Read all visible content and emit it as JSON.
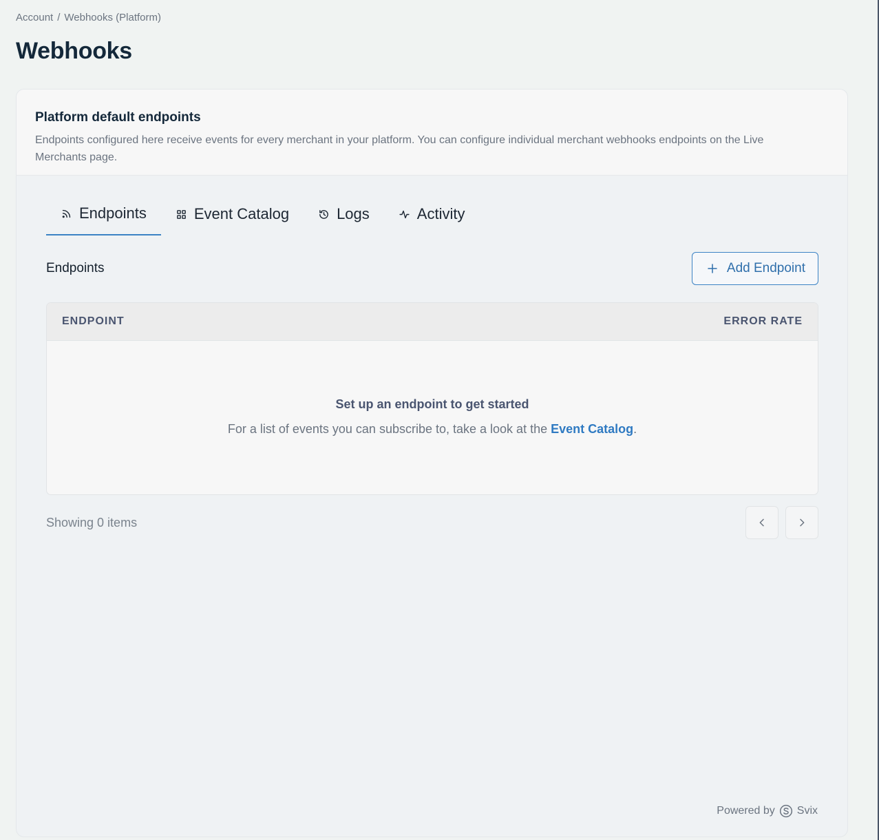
{
  "breadcrumb": {
    "items": [
      "Account",
      "/",
      "Webhooks (Platform)"
    ]
  },
  "page": {
    "title": "Webhooks"
  },
  "card": {
    "title": "Platform default endpoints",
    "description": "Endpoints configured here receive events for every merchant in your platform. You can configure individual merchant webhooks endpoints on the Live Merchants page."
  },
  "tabs": [
    {
      "label": "Endpoints",
      "icon": "rss-icon",
      "active": true
    },
    {
      "label": "Event Catalog",
      "icon": "grid-icon",
      "active": false
    },
    {
      "label": "Logs",
      "icon": "history-icon",
      "active": false
    },
    {
      "label": "Activity",
      "icon": "activity-icon",
      "active": false
    }
  ],
  "endpoints": {
    "section_title": "Endpoints",
    "add_button_label": "Add Endpoint",
    "table": {
      "columns": [
        "ENDPOINT",
        "ERROR RATE"
      ],
      "empty_title": "Set up an endpoint to get started",
      "empty_text_prefix": "For a list of events you can subscribe to, take a look at the ",
      "empty_text_link": "Event Catalog",
      "empty_text_suffix": "."
    },
    "showing": "Showing 0 items"
  },
  "footer": {
    "powered_by": "Powered by",
    "brand": "Svix"
  },
  "colors": {
    "accent": "#3b82c4",
    "link": "#2f7ac2",
    "background": "#f0f3f2"
  }
}
